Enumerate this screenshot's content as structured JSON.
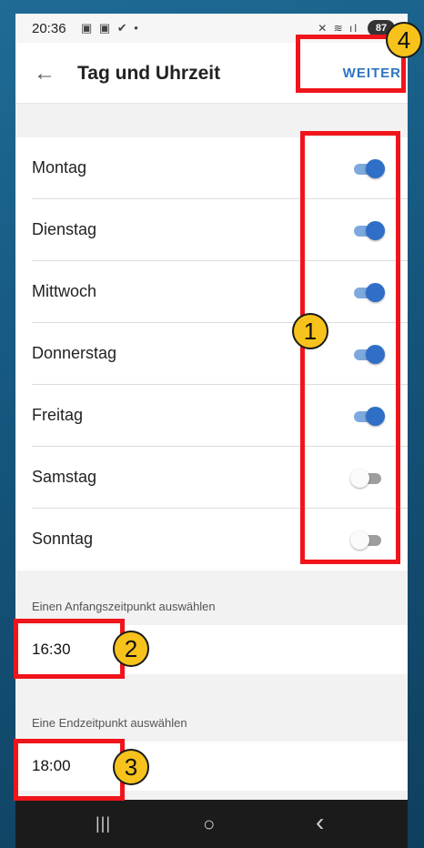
{
  "status_bar": {
    "time": "20:36",
    "notification_icons": "▣ ▣ ✔ •",
    "right_icons": "✕ ≋ ıl",
    "battery": "87"
  },
  "app_bar": {
    "back_icon": "←",
    "title": "Tag und Uhrzeit",
    "next_label": "WEITER"
  },
  "days": [
    {
      "label": "Montag",
      "enabled": true
    },
    {
      "label": "Dienstag",
      "enabled": true
    },
    {
      "label": "Mittwoch",
      "enabled": true
    },
    {
      "label": "Donnerstag",
      "enabled": true
    },
    {
      "label": "Freitag",
      "enabled": true
    },
    {
      "label": "Samstag",
      "enabled": false
    },
    {
      "label": "Sonntag",
      "enabled": false
    }
  ],
  "start_time": {
    "label": "Einen Anfangszeitpunkt auswählen",
    "value": "16:30"
  },
  "end_time": {
    "label": "Eine Endzeitpunkt auswählen",
    "value": "18:00"
  },
  "nav_bar": {
    "recents": "|||",
    "home": "○",
    "back": "‹"
  },
  "annotations": [
    "1",
    "2",
    "3",
    "4"
  ],
  "colors": {
    "accent": "#2f74c0",
    "toggle_on": "#2f6fc7",
    "annotation_box": "#f0141b",
    "annotation_badge": "#f7c21b"
  }
}
